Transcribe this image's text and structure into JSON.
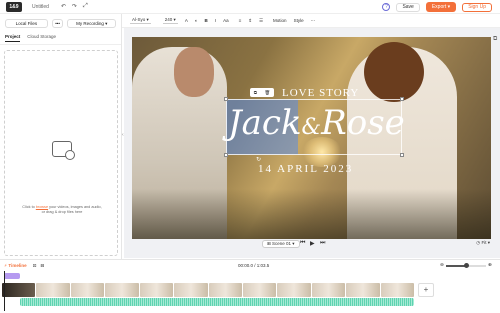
{
  "app": {
    "logo": "1&9",
    "title": "Untitled"
  },
  "topbar": {
    "save_label": "Save",
    "export_label": "Export",
    "signup_label": "Sign Up"
  },
  "upload": {
    "local_files": "Local Files",
    "more": "•••",
    "my_recording": "My Recording"
  },
  "panel_tabs": [
    {
      "label": "Project"
    },
    {
      "label": "Cloud Storage"
    }
  ],
  "dropzone": {
    "text_before": "Click to ",
    "link": "browse",
    "text_after": " your videos, images and audio, or drag & drop files here"
  },
  "format_bar": {
    "font": "Al-Syo",
    "size": "240",
    "bold": "B",
    "italic": "I",
    "case": "Aa",
    "motion": "Motion",
    "style": "Style"
  },
  "video_text": {
    "love_story": "LOVE STORY",
    "name1": "Jack",
    "amp": "&",
    "name2": "Rose",
    "date": "14 APRIL 2023"
  },
  "playback": {
    "scene": "Scene 01",
    "fit": "Fit"
  },
  "timeline": {
    "tab": "Timeline",
    "time": "00:00.0 / 1:03.5",
    "zoom": 0.5
  },
  "icons": {
    "undo": "undo-icon",
    "redo": "redo-icon",
    "fullscreen": "fullscreen-icon",
    "help": "help-icon"
  }
}
